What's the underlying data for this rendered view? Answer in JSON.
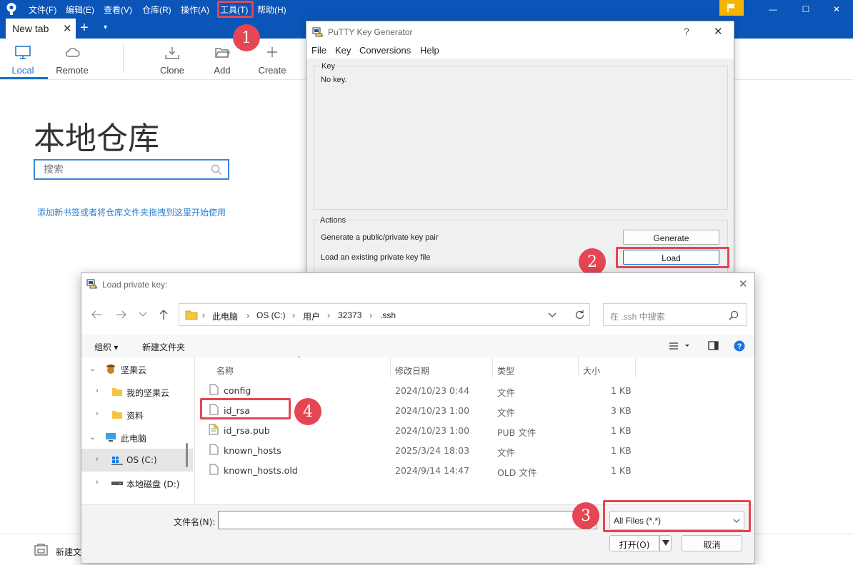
{
  "menubar": {
    "items": [
      "文件(F)",
      "编辑(E)",
      "查看(V)",
      "仓库(R)",
      "操作(A)",
      "工具(T)",
      "帮助(H)"
    ]
  },
  "tabs": {
    "active_label": "New tab",
    "close_glyph": "✕",
    "add_glyph": "+",
    "menu_glyph": "▾"
  },
  "window_controls": {
    "minimize": "—",
    "maximize": "☐",
    "close": "✕"
  },
  "toolbar": {
    "local": "Local",
    "remote": "Remote",
    "clone": "Clone",
    "add": "Add",
    "create": "Create"
  },
  "main": {
    "title": "本地仓库",
    "search_placeholder": "搜索",
    "hint": "添加新书签或者将仓库文件夹拖拽到这里开始使用"
  },
  "bottom_bar": {
    "label": "新建文"
  },
  "putty": {
    "title": "PuTTY Key Generator",
    "help_glyph": "?",
    "close_glyph": "✕",
    "menu": [
      "File",
      "Key",
      "Conversions",
      "Help"
    ],
    "key_group": "Key",
    "key_text": "No key.",
    "actions_group": "Actions",
    "generate_label": "Generate a public/private key pair",
    "generate_button": "Generate",
    "load_label": "Load an existing private key file",
    "load_button": "Load"
  },
  "load_dialog": {
    "title": "Load private key:",
    "close_glyph": "✕",
    "breadcrumb": [
      "此电脑",
      "OS (C:)",
      "用户",
      "32373",
      ".ssh"
    ],
    "search_placeholder": "在 .ssh 中搜索",
    "organize": "组织 ▾",
    "new_folder": "新建文件夹",
    "columns": {
      "name": "名称",
      "modified": "修改日期",
      "type": "类型",
      "size": "大小"
    },
    "nav": [
      {
        "label": "坚果云",
        "expanded": true
      },
      {
        "label": "我的坚果云",
        "expanded": false
      },
      {
        "label": "资料",
        "expanded": false
      },
      {
        "label": "此电脑",
        "expanded": true
      },
      {
        "label": "OS (C:)",
        "expanded": false,
        "selected": true
      },
      {
        "label": "本地磁盘 (D:)",
        "expanded": false
      }
    ],
    "files": [
      {
        "name": "config",
        "modified": "2024/10/23 0:44",
        "type": "文件",
        "size": "1 KB"
      },
      {
        "name": "id_rsa",
        "modified": "2024/10/23 1:00",
        "type": "文件",
        "size": "3 KB"
      },
      {
        "name": "id_rsa.pub",
        "modified": "2024/10/23 1:00",
        "type": "PUB 文件",
        "size": "1 KB"
      },
      {
        "name": "known_hosts",
        "modified": "2025/3/24 18:03",
        "type": "文件",
        "size": "1 KB"
      },
      {
        "name": "known_hosts.old",
        "modified": "2024/9/14 14:47",
        "type": "OLD 文件",
        "size": "1 KB"
      }
    ],
    "filename_label": "文件名(N):",
    "filename_value": "",
    "filter": "All Files (*.*)",
    "open_button": "打开(O)",
    "cancel_button": "取消"
  },
  "annotations": [
    "1",
    "2",
    "3",
    "4"
  ],
  "colors": {
    "accent": "#0b55b8",
    "highlight": "#e64553",
    "link": "#2a7fd0"
  }
}
